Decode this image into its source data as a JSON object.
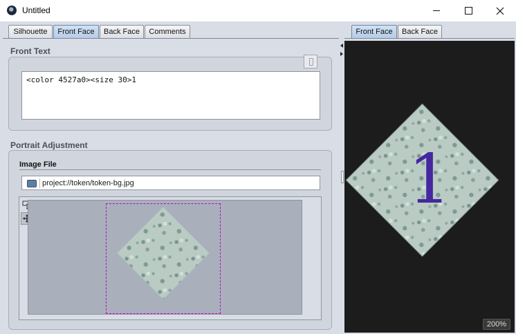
{
  "window": {
    "title": "Untitled"
  },
  "left_tabs": [
    {
      "label": "Silhouette",
      "active": false
    },
    {
      "label": "Front Face",
      "active": true
    },
    {
      "label": "Back Face",
      "active": false
    },
    {
      "label": "Comments",
      "active": false
    }
  ],
  "front_text": {
    "section_title": "Front Text",
    "value": "<color 4527a0><size 30>1"
  },
  "portrait": {
    "section_title": "Portrait Adjustment",
    "image_file_label": "Image File",
    "path": "project://token/token-bg.jpg"
  },
  "right_tabs": [
    {
      "label": "Front Face",
      "active": true
    },
    {
      "label": "Back Face",
      "active": false
    }
  ],
  "preview": {
    "token_text": "1",
    "text_color": "#4527a0",
    "zoom": "200%"
  },
  "icons": [
    "app-icon",
    "minimize-icon",
    "maximize-icon",
    "close-icon",
    "folder-icon",
    "pointer-tool-icon",
    "move-tool-icon"
  ]
}
